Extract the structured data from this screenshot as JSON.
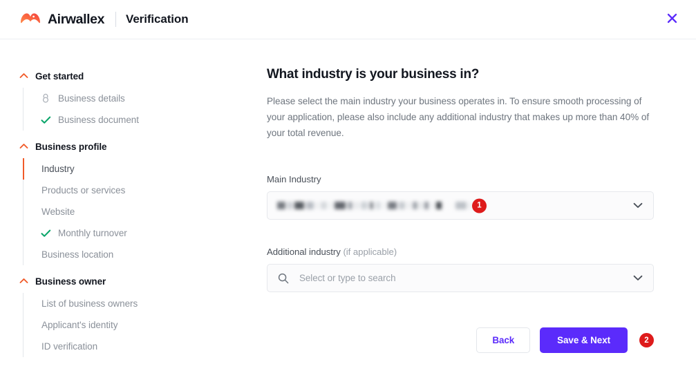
{
  "header": {
    "brand_name": "Airwallex",
    "title": "Verification",
    "close_icon": "close-icon"
  },
  "sidebar": {
    "sections": [
      {
        "title": "Get started",
        "expanded": true,
        "items": [
          {
            "label": "Business details",
            "icon": "lock-icon",
            "state": "locked"
          },
          {
            "label": "Business document",
            "icon": "check-icon",
            "state": "complete"
          }
        ]
      },
      {
        "title": "Business profile",
        "expanded": true,
        "items": [
          {
            "label": "Industry",
            "icon": "",
            "state": "active"
          },
          {
            "label": "Products or services",
            "icon": "",
            "state": "default"
          },
          {
            "label": "Website",
            "icon": "",
            "state": "default"
          },
          {
            "label": "Monthly turnover",
            "icon": "check-icon",
            "state": "complete"
          },
          {
            "label": "Business location",
            "icon": "",
            "state": "default"
          }
        ]
      },
      {
        "title": "Business owner",
        "expanded": true,
        "items": [
          {
            "label": "List of business owners",
            "icon": "",
            "state": "default"
          },
          {
            "label": "Applicant's identity",
            "icon": "",
            "state": "default"
          },
          {
            "label": "ID verification",
            "icon": "",
            "state": "default"
          }
        ]
      }
    ]
  },
  "main": {
    "title": "What industry is your business in?",
    "description": "Please select the main industry your business operates in. To ensure smooth processing of your application, please also include any additional industry that makes up more than 40% of your total revenue.",
    "main_industry": {
      "label": "Main Industry",
      "value": "",
      "value_redacted": true,
      "badge": "1"
    },
    "additional_industry": {
      "label_main": "Additional industry ",
      "label_hint": "(if applicable)",
      "placeholder": "Select or type to search",
      "value": ""
    },
    "actions": {
      "back_label": "Back",
      "save_label": "Save & Next",
      "save_badge": "2"
    }
  },
  "colors": {
    "brand_orange": "#F15A29",
    "primary_purple": "#5B2BFB",
    "badge_red": "#DE1B1B",
    "check_green": "#0CA66B",
    "text_dark": "#12161F",
    "text_muted": "#8A9099"
  }
}
